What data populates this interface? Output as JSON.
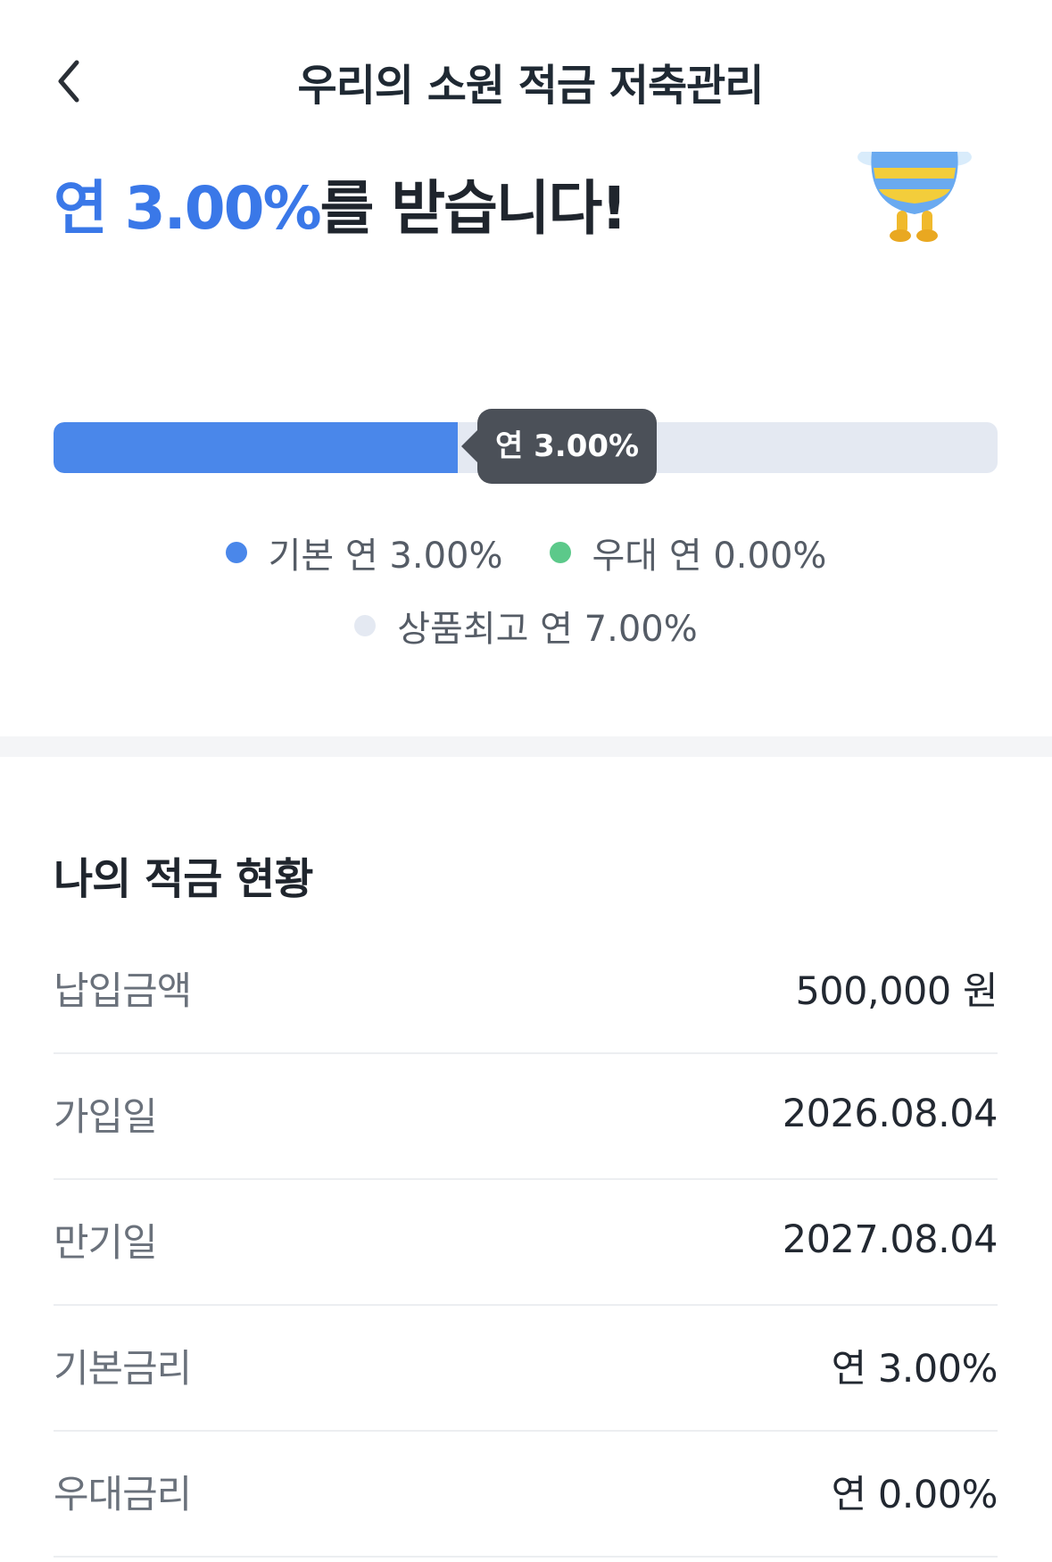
{
  "header": {
    "title": "우리의 소원 적금 저축관리",
    "back_icon": "chevron-left-icon"
  },
  "hero": {
    "accent_text": "연 3.00%",
    "rest_text": "를 받습니다!",
    "mascot_icon": "bee-mascot-icon"
  },
  "rate_bar": {
    "current_fraction": 0.4286,
    "tooltip": "연 3.00%",
    "colors": {
      "base": "#4a87ea",
      "preferential": "#5cc98a",
      "max": "#e4e9f2"
    }
  },
  "legend": {
    "base": "기본 연 3.00%",
    "preferential": "우대 연 0.00%",
    "max": "상품최고 연 7.00%"
  },
  "status": {
    "title": "나의 적금 현황",
    "rows": [
      {
        "label": "납입금액",
        "value": "500,000 원"
      },
      {
        "label": "가입일",
        "value": "2026.08.04"
      },
      {
        "label": "만기일",
        "value": "2027.08.04"
      },
      {
        "label": "기본금리",
        "value": "연 3.00%"
      },
      {
        "label": "우대금리",
        "value": "연 0.00%"
      }
    ]
  }
}
